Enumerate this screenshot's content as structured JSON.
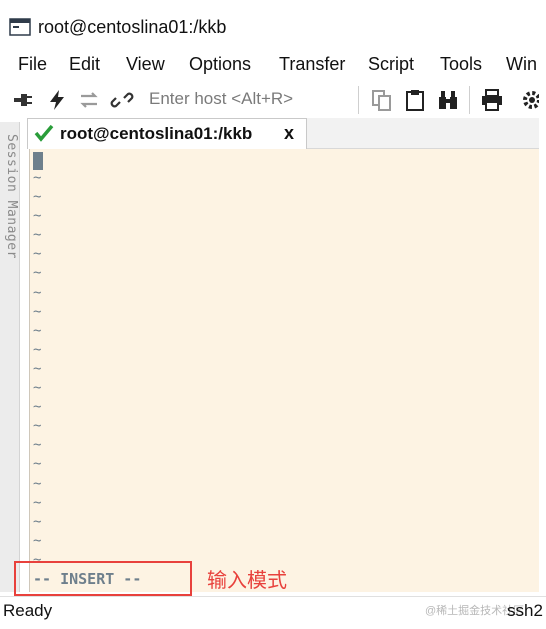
{
  "window": {
    "title": "root@centoslina01:/kkb"
  },
  "menu": [
    "File",
    "Edit",
    "View",
    "Options",
    "Transfer",
    "Script",
    "Tools",
    "Win"
  ],
  "toolbar": {
    "host_placeholder": "Enter host <Alt+R>"
  },
  "session_manager": {
    "label": "Session Manager"
  },
  "tab": {
    "title": "root@centoslina01:/kkb",
    "close": "x"
  },
  "terminal": {
    "tilde": "~",
    "tilde_count": 21,
    "mode_line": "-- INSERT --"
  },
  "annotation": {
    "text": "输入模式",
    "color": "#e8413c"
  },
  "statusbar": {
    "state": "Ready",
    "protocol": "ssh2",
    "watermark": "@稀土掘金技术社区"
  },
  "colors": {
    "terminal_bg": "#fdf3e3",
    "terminal_fg": "#6e7f8c",
    "check_green": "#2a9d3a"
  }
}
